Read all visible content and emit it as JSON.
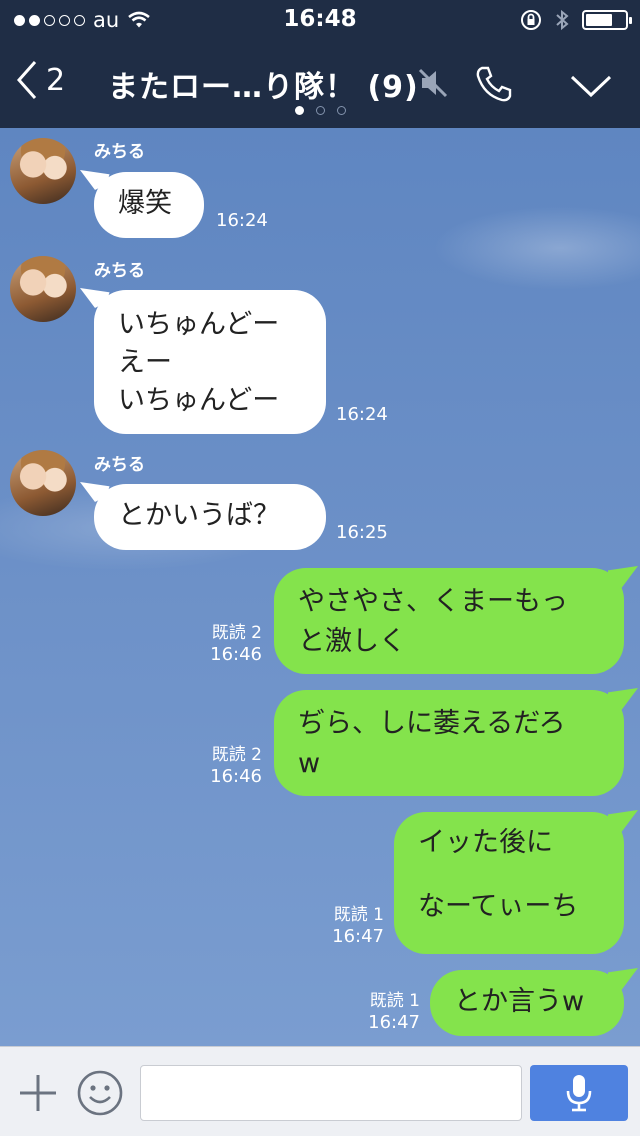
{
  "status_bar": {
    "carrier": "au",
    "time": "16:48",
    "signal_bars_filled": 2,
    "signal_bars_total": 5,
    "battery_level": 0.62
  },
  "nav": {
    "back_count": "2",
    "title": "またロー…り隊！ (9)",
    "page_count": 3,
    "current_page": 1
  },
  "messages": [
    {
      "sender": "みちる",
      "text": "爆笑",
      "time": "16:24"
    },
    {
      "sender": "みちる",
      "lines": [
        "いちゅんどー",
        "えー",
        "いちゅんどー"
      ],
      "time": "16:24"
    },
    {
      "sender": "みちる",
      "text": "とかいうば？",
      "time": "16:25"
    },
    {
      "read": "既読 2",
      "lines": [
        "やさやさ、くまーもっ",
        "と激しく"
      ],
      "time": "16:46"
    },
    {
      "read": "既読 2",
      "lines": [
        "ぢら、しに萎えるだろ",
        "w"
      ],
      "time": "16:46"
    },
    {
      "read": "既読 1",
      "lines": [
        "イッた後に",
        "",
        "なーてぃーち"
      ],
      "time": "16:47"
    },
    {
      "read": "既読 1",
      "text": "とか言うw",
      "time": "16:47"
    }
  ],
  "input": {
    "placeholder": ""
  },
  "colors": {
    "header_bg": "#1f2d45",
    "outgoing_bubble": "#84e34c",
    "incoming_bubble": "#ffffff",
    "send_button": "#4f82e0"
  },
  "icons": [
    "signal-dots-icon",
    "wifi-icon",
    "rotation-lock-icon",
    "bluetooth-icon",
    "battery-icon",
    "back-chevron-icon",
    "mute-icon",
    "phone-icon",
    "chevron-down-icon",
    "plus-icon",
    "smiley-icon",
    "mic-icon"
  ]
}
